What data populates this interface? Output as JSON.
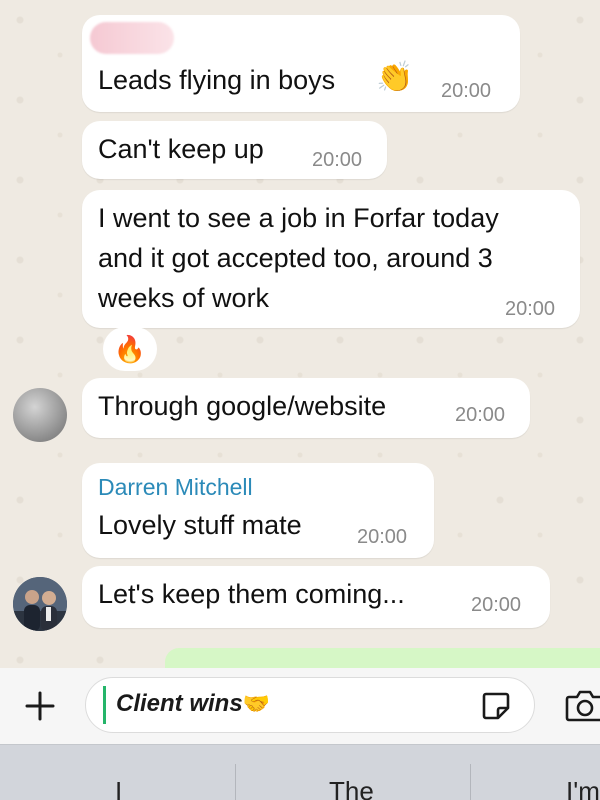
{
  "messages": [
    {
      "text": "Leads flying in boys",
      "emoji": "👏",
      "time": "20:00"
    },
    {
      "text": "Can't keep up",
      "time": "20:00"
    },
    {
      "lines": [
        "I went to see a job in Forfar today",
        "and it got accepted too, around 3",
        "weeks of work"
      ],
      "time": "20:00",
      "reaction": "🔥"
    },
    {
      "text": "Through google/website",
      "time": "20:00"
    },
    {
      "sender": "Darren Mitchell",
      "text": "Lovely stuff mate",
      "time": "20:00"
    },
    {
      "text": "Let's keep them coming...",
      "time": "20:00"
    }
  ],
  "composer": {
    "text": "Client wins",
    "emoji": "🤝"
  },
  "keyboard": {
    "suggestions": [
      "I",
      "The",
      "I'm"
    ]
  },
  "colors": {
    "chat_background": "#efeae2",
    "bubble": "#ffffff",
    "sender_name": "#2b8ab8",
    "timestamp": "#8a8a8a",
    "caret": "#25b56a",
    "keyboard_background": "#d2d5db"
  }
}
